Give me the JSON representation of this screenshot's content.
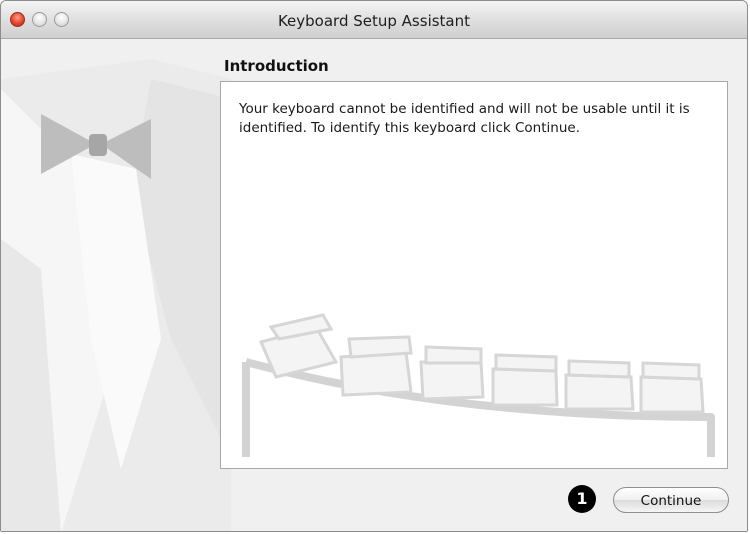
{
  "window": {
    "title": "Keyboard Setup Assistant"
  },
  "section": {
    "heading": "Introduction"
  },
  "message": {
    "text": "Your keyboard cannot be identified and will not be usable until it is identified. To identify this keyboard click Continue."
  },
  "callout": {
    "number": "1"
  },
  "footer": {
    "continue_label": "Continue"
  },
  "icons": {
    "close": "close-icon",
    "minimize": "minimize-icon",
    "zoom": "zoom-icon"
  },
  "colors": {
    "close_button": "#e4462e",
    "window_bg": "#f0f0f0",
    "panel_bg": "#ffffff"
  }
}
